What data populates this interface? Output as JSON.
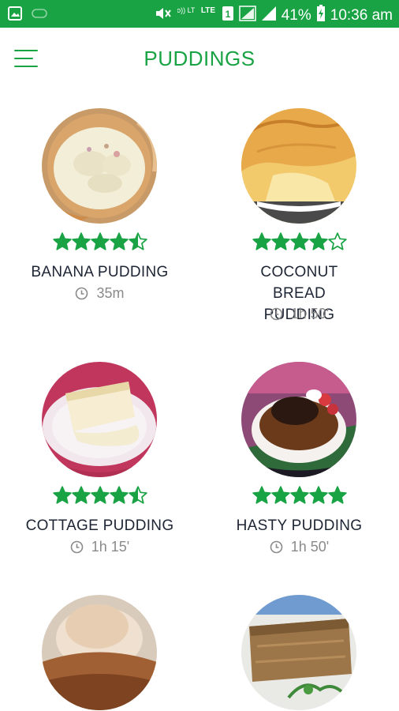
{
  "status_bar": {
    "battery_percent": "41%",
    "clock": "10:36 am",
    "volte_label": "Vo)) LTE",
    "lte_label": "LTE",
    "sim_label": "1"
  },
  "app_bar": {
    "title": "PUDDINGS"
  },
  "colors": {
    "accent": "#1aa344",
    "text_dark": "#1d2433",
    "text_muted": "#8a8a8a"
  },
  "recipes": [
    {
      "name": "BANANA PUDDING",
      "time": "35m",
      "rating": 4.5
    },
    {
      "name": "COCONUT BREAD PUDDING",
      "time": "1h 50'",
      "rating": 4
    },
    {
      "name": "COTTAGE PUDDING",
      "time": "1h 15'",
      "rating": 4.5
    },
    {
      "name": "HASTY PUDDING",
      "time": "1h 50'",
      "rating": 5
    },
    {
      "name": "",
      "time": "",
      "rating": null
    },
    {
      "name": "",
      "time": "",
      "rating": null
    }
  ]
}
